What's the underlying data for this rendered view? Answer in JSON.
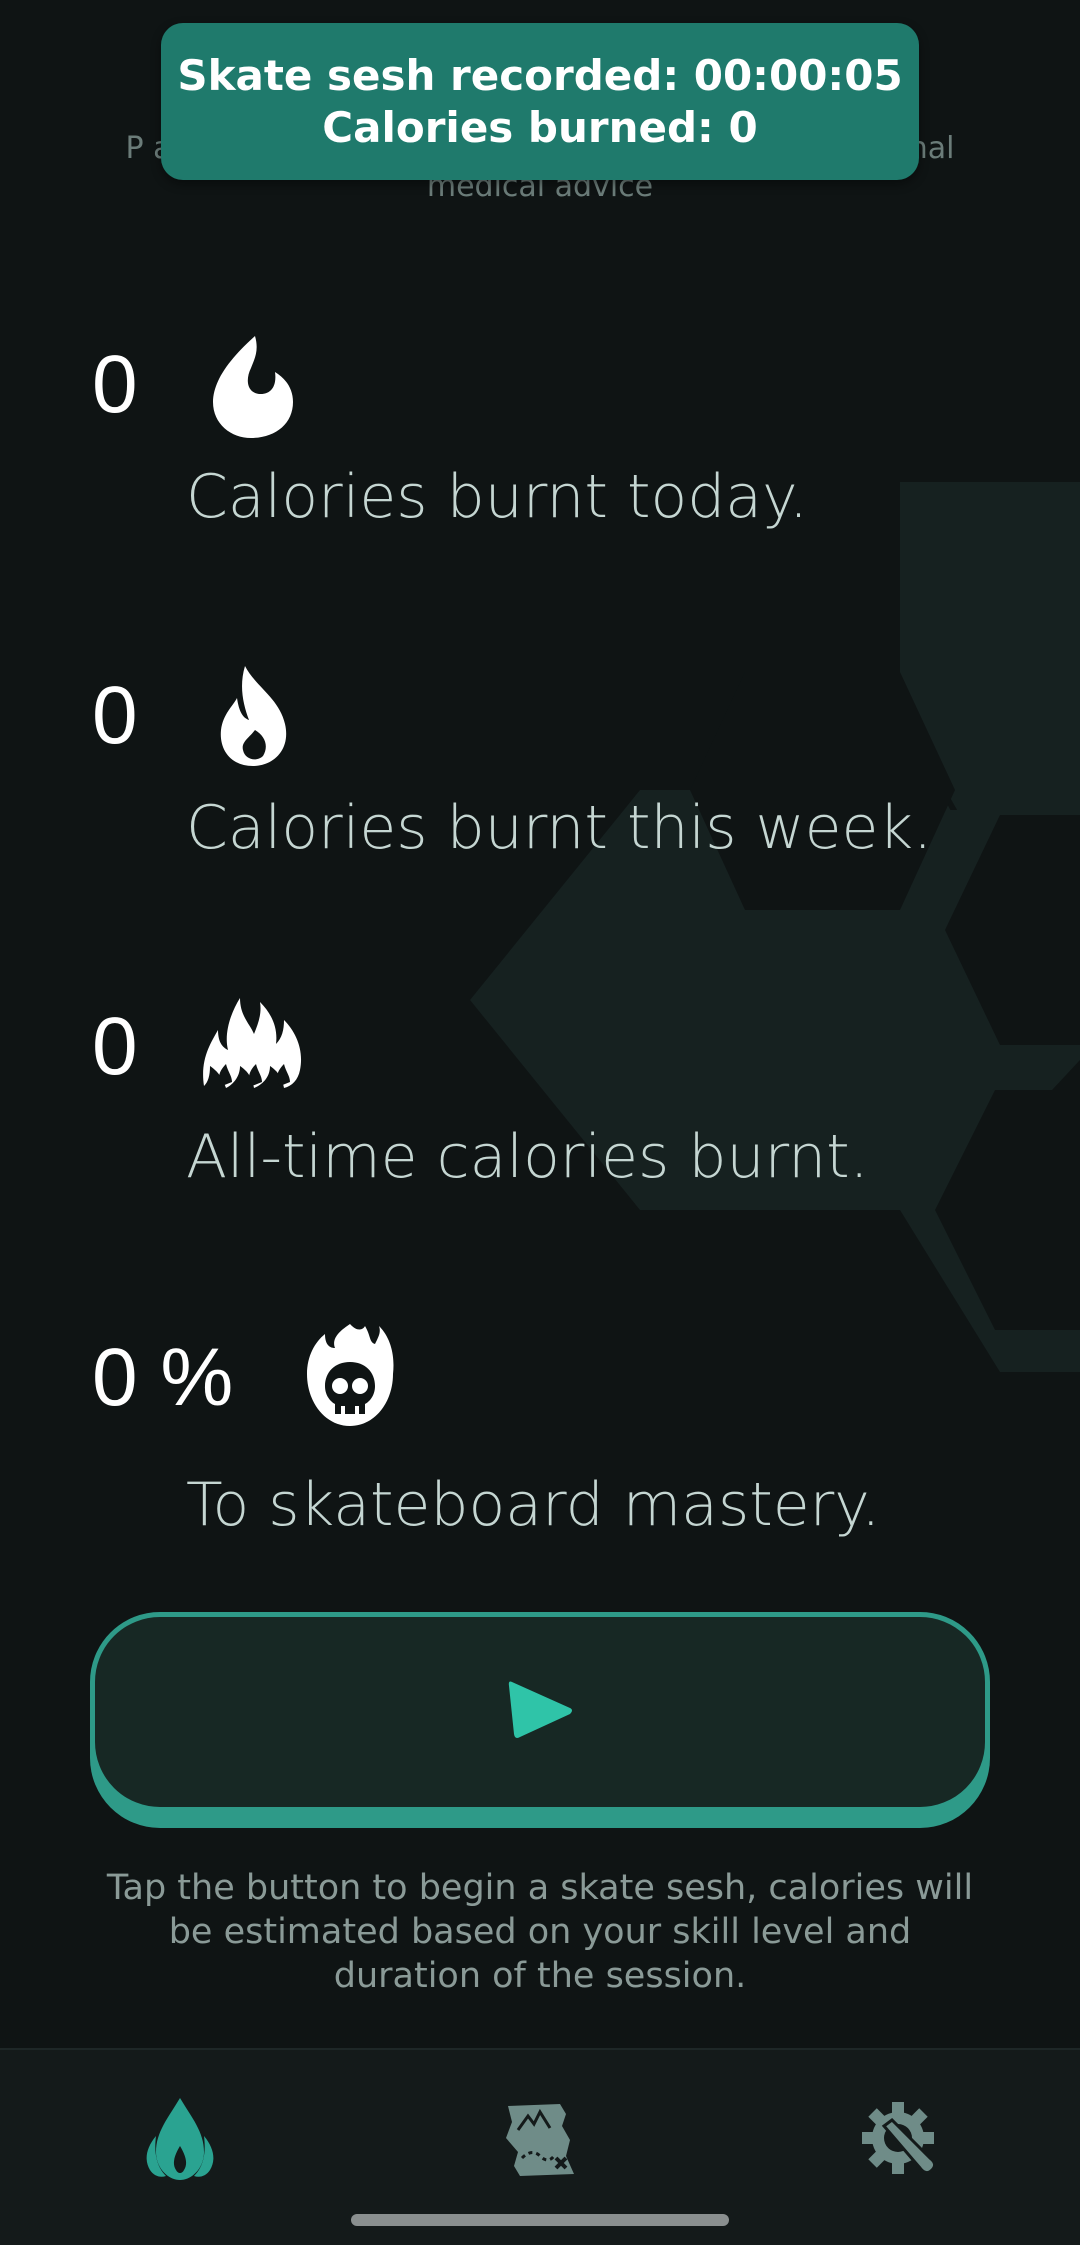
{
  "toast": {
    "line1": "Skate sesh recorded: 00:00:05",
    "line2": "Calories burned: 0"
  },
  "disclaimer": "P                                                                    al purposes only and not a substitute for professional medical advice",
  "stats": {
    "today": {
      "value": "0",
      "caption": "Calories burnt today.",
      "icon": "drop-flame-icon"
    },
    "week": {
      "value": "0",
      "caption": "Calories burnt this week.",
      "icon": "flame-icon"
    },
    "alltime": {
      "value": "0",
      "caption": "All-time calories burnt.",
      "icon": "triple-flames-icon"
    },
    "mastery": {
      "value": "0 %",
      "caption": "To skateboard mastery.",
      "icon": "flaming-skull-icon"
    }
  },
  "play_button": {
    "icon": "play-icon"
  },
  "hint": "Tap the button to begin a skate sesh, calories will be estimated based on your skill level and duration of the session.",
  "nav": {
    "items": [
      {
        "name": "home",
        "icon": "flame-drop-icon",
        "active": true
      },
      {
        "name": "map",
        "icon": "treasure-map-icon",
        "active": false
      },
      {
        "name": "settings",
        "icon": "gear-wrench-icon",
        "active": false
      }
    ]
  },
  "colors": {
    "background": "#0f1414",
    "accent": "#2fc4a8",
    "toast": "#1f7a6c",
    "button_border": "#2e9a88",
    "inactive_icon": "#6f8c88"
  }
}
